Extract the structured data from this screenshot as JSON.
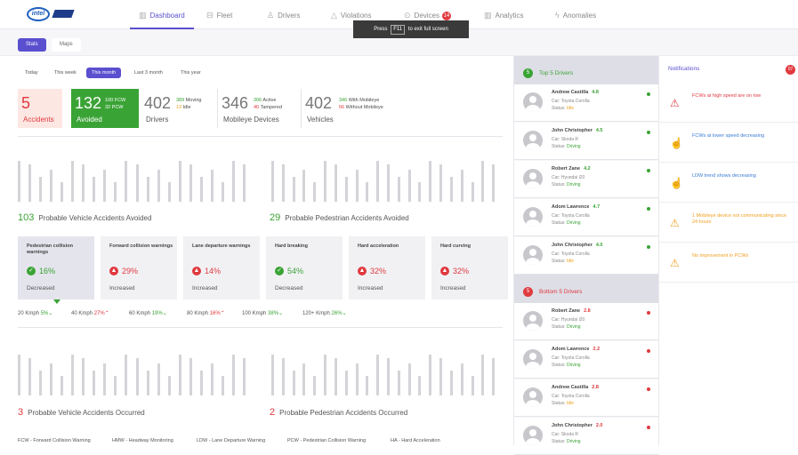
{
  "brand": {
    "logo_text": "intel",
    "sub_logo": "mobileye"
  },
  "nav": [
    {
      "label": "Dashboard",
      "icon": "bar-chart-icon",
      "active": true
    },
    {
      "label": "Fleet",
      "icon": "bus-icon"
    },
    {
      "label": "Drivers",
      "icon": "user-icon"
    },
    {
      "label": "Violations",
      "icon": "warning-icon"
    },
    {
      "label": "Devices",
      "icon": "device-icon",
      "badge": "14"
    },
    {
      "label": "Analytics",
      "icon": "analytics-icon"
    },
    {
      "label": "Anomalies",
      "icon": "bolt-icon"
    }
  ],
  "toast": {
    "pre": "Press",
    "key": "F11",
    "post": "to exit full screen"
  },
  "view_tabs": [
    "Stats",
    "Maps"
  ],
  "ranges": [
    "Today",
    "This week",
    "This month",
    "Last 3 month",
    "This year"
  ],
  "kpis": {
    "accidents": {
      "value": "5",
      "label": "Accidents"
    },
    "avoided": {
      "value": "132",
      "fcw_n": "100",
      "fcw": "FCW",
      "pcw_n": "32",
      "pcw": "PCW",
      "label": "Avoided"
    },
    "drivers": {
      "value": "402",
      "moving_n": "389",
      "moving": "Moving",
      "idle_n": "13",
      "idle": "Idle",
      "label": "Drivers"
    },
    "devices": {
      "value": "346",
      "active_n": "306",
      "active": "Active",
      "tampered_n": "40",
      "tampered": "Tampered",
      "label": "Mobileye Devices"
    },
    "vehicles": {
      "value": "402",
      "with_n": "346",
      "with": "With Mobileye",
      "without_n": "56",
      "without": "Without Mobileye",
      "label": "Vehicles"
    }
  },
  "metrics_top": [
    {
      "value": "103",
      "label": "Probable Vehicle Accidents Avoided"
    },
    {
      "value": "29",
      "label": "Probable Pedestrian Accidents Avoided"
    }
  ],
  "cards": [
    {
      "title": "Pedestrian collision warnings",
      "pct": "16%",
      "trend": "Decreased",
      "up": false
    },
    {
      "title": "Forward collision warnings",
      "pct": "29%",
      "trend": "Increased",
      "up": true
    },
    {
      "title": "Lane departure warnings",
      "pct": "14%",
      "trend": "Increased",
      "up": true
    },
    {
      "title": "Hard breaking",
      "pct": "54%",
      "trend": "Decreased",
      "up": false
    },
    {
      "title": "Hard acceleration",
      "pct": "32%",
      "trend": "Increased",
      "up": true
    },
    {
      "title": "Hard curving",
      "pct": "32%",
      "trend": "Increased",
      "up": true
    }
  ],
  "speeds": [
    {
      "label": "20 Kmph",
      "pct": "5%",
      "up": false
    },
    {
      "label": "40 Kmph",
      "pct": "27%",
      "up": true
    },
    {
      "label": "60 Kmph",
      "pct": "19%",
      "up": false
    },
    {
      "label": "80 Kmph",
      "pct": "16%",
      "up": true
    },
    {
      "label": "100 Kmph",
      "pct": "38%",
      "up": false
    },
    {
      "label": "120+ Kmph",
      "pct": "26%",
      "up": false
    }
  ],
  "metrics_bottom": [
    {
      "value": "3",
      "label": "Probable Vehicle Accidents Occurred"
    },
    {
      "value": "2",
      "label": "Probable Pedestrian Accidents Occurred"
    }
  ],
  "legend": [
    "FCW - Forward Collision Warning",
    "HMW - Headway Monitoring",
    "LDW - Lane Departure Warning",
    "PCW - Pedestrian Collision Warning",
    "HA - Hard Acceleration"
  ],
  "top_drivers": {
    "count": "5",
    "title": "Top 5 Drivers",
    "rows": [
      {
        "name": "Andrew Castilla",
        "score": "4.8",
        "car": "Car: Toyota Corolla",
        "status_label": "Status:",
        "status": "Idle"
      },
      {
        "name": "John Christopher",
        "score": "4.5",
        "car": "Car: Skoda R",
        "status_label": "Status:",
        "status": "Driving"
      },
      {
        "name": "Robert Zane",
        "score": "4.2",
        "car": "Car: Hyundai i20",
        "status_label": "Status:",
        "status": "Driving"
      },
      {
        "name": "Adom Lawrence",
        "score": "4.7",
        "car": "Car: Toyota Corolla",
        "status_label": "Status:",
        "status": "Driving"
      },
      {
        "name": "John Christopher",
        "score": "4.0",
        "car": "Car: Toyota Corolla",
        "status_label": "Status:",
        "status": "Idle"
      }
    ]
  },
  "bottom_drivers": {
    "count": "5",
    "title": "Bottom 5 Drivers",
    "rows": [
      {
        "name": "Robert Zane",
        "score": "2.8",
        "car": "Car: Hyundai i20",
        "status_label": "Status:",
        "status": "Driving"
      },
      {
        "name": "Adom Lawrence",
        "score": "2.2",
        "car": "Car: Toyota Corolla",
        "status_label": "Status:",
        "status": "Driving"
      },
      {
        "name": "Andrew Castilla",
        "score": "2.8",
        "car": "Car: Toyota Corolla",
        "status_label": "Status:",
        "status": "Idle"
      },
      {
        "name": "John Christopher",
        "score": "2.0",
        "car": "Car: Skoda R",
        "status_label": "Status:",
        "status": "Driving"
      }
    ]
  },
  "notifications": {
    "title": "Notifications",
    "badge": "07",
    "items": [
      {
        "text": "FCWs at high speed are on rise",
        "icon": "warning-icon",
        "kind": "danger"
      },
      {
        "text": "FCWs at lower speed decreasing",
        "icon": "thumbs-up-icon",
        "kind": "info"
      },
      {
        "text": "LDW trend shows decreasing",
        "icon": "thumbs-up-icon",
        "kind": "info"
      },
      {
        "text": "1 Mobileye device not communicating since 24 hours",
        "icon": "warning-icon",
        "kind": "warn"
      },
      {
        "text": "No improvement in PCWs",
        "icon": "warning-icon",
        "kind": "warn"
      }
    ]
  },
  "colors": {
    "accent": "#5a4fcf",
    "green": "#3aa335",
    "red": "#e0393e",
    "orange": "#f0a020",
    "blue": "#3a7bd5"
  }
}
